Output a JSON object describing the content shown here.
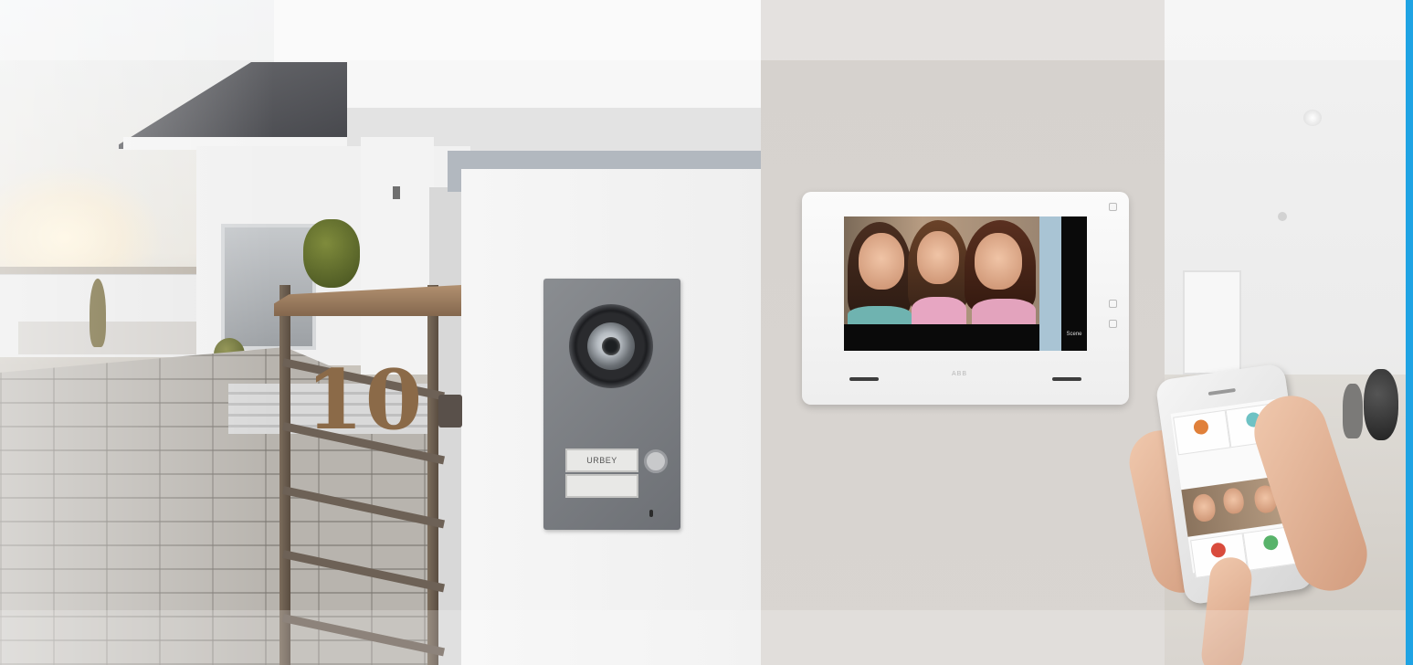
{
  "scene": {
    "caption": "",
    "panels": [
      "house-exterior",
      "indoor-monitor",
      "smartphone-app"
    ]
  },
  "house": {
    "number": "10"
  },
  "door_station": {
    "nameplate_top": "URBEY",
    "nameplate_bottom": ""
  },
  "monitor": {
    "brand": "ABB",
    "sidebar_label": "Scene"
  },
  "colors": {
    "accent_edge": "#1fa3e3",
    "wall": "#f3f3f3",
    "monitor_wall": "#d6d2ce"
  },
  "icons": [
    "camera-lens-icon",
    "call-button-icon",
    "answer-icon",
    "unlock-icon",
    "hangup-icon"
  ]
}
